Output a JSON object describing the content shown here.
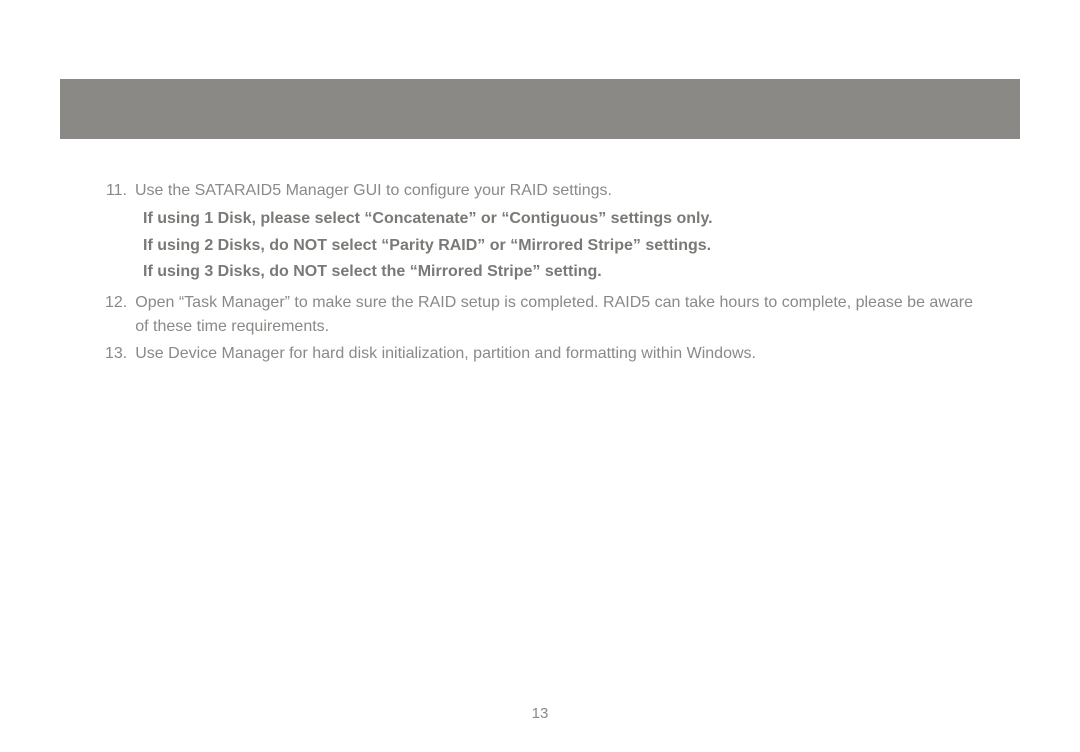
{
  "items": {
    "item11": {
      "number": "11.",
      "text": "Use the SATARAID5 Manager GUI to configure your RAID settings.",
      "bold1": "If using 1 Disk, please select “Concatenate” or “Contiguous” settings only.",
      "bold2": "If using 2 Disks, do NOT select “Parity RAID” or “Mirrored Stripe” settings.",
      "bold3": "If using 3 Disks, do NOT select the “Mirrored Stripe” setting."
    },
    "item12": {
      "number": "12.",
      "text": "Open “Task Manager” to make sure the RAID setup is completed.  RAID5 can take hours to complete, please be aware of these time requirements."
    },
    "item13": {
      "number": "13.",
      "text": "Use Device Manager for hard disk initialization, partition and formatting within Windows."
    }
  },
  "pageNumber": "13"
}
